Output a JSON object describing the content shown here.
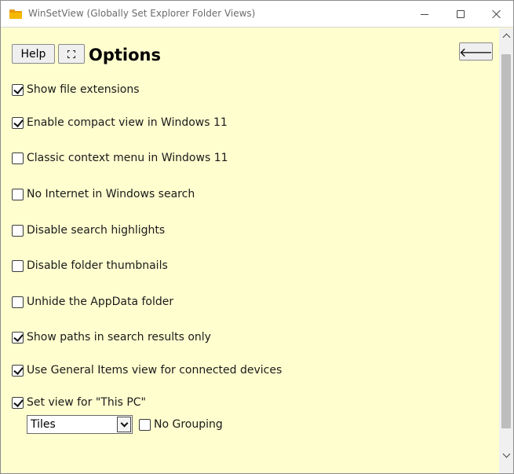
{
  "window": {
    "title": "WinSetView (Globally Set Explorer Folder Views)",
    "app_icon": "folder-icon"
  },
  "toolbar": {
    "help_label": "Help",
    "expand_icon": "fullscreen-icon",
    "heading": "Options",
    "back_icon": "arrow-left-icon",
    "back_label": "🡐"
  },
  "options": [
    {
      "label": "Show file extensions",
      "checked": true
    },
    {
      "label": "Enable compact view in Windows 11",
      "checked": true
    },
    {
      "label": "Classic context menu in Windows 11",
      "checked": false
    },
    {
      "label": "No Internet in Windows search",
      "checked": false
    },
    {
      "label": "Disable search highlights",
      "checked": false
    },
    {
      "label": "Disable folder thumbnails",
      "checked": false
    },
    {
      "label": "Unhide the AppData folder",
      "checked": false
    },
    {
      "label": "Show paths in search results only",
      "checked": true
    },
    {
      "label": "Use General Items view for connected devices",
      "checked": true
    },
    {
      "label": "Set view for \"This PC\"",
      "checked": true
    }
  ],
  "this_pc": {
    "view_value": "Tiles",
    "no_grouping_label": "No Grouping",
    "no_grouping_checked": false
  }
}
